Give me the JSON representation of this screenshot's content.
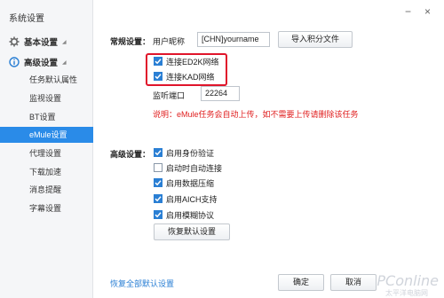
{
  "window": {
    "title": "系统设置"
  },
  "controls": {
    "minimize": "−",
    "close": "×"
  },
  "sidebar": {
    "groups": [
      {
        "label": "基本设置",
        "icon": "gear-icon"
      },
      {
        "label": "高级设置",
        "icon": "info-circle-icon"
      }
    ],
    "items": [
      {
        "label": "任务默认属性"
      },
      {
        "label": "监视设置"
      },
      {
        "label": "BT设置"
      },
      {
        "label": "eMule设置",
        "active": true
      },
      {
        "label": "代理设置"
      },
      {
        "label": "下载加速"
      },
      {
        "label": "消息提醒"
      },
      {
        "label": "字幕设置"
      }
    ]
  },
  "general": {
    "section_label": "常规设置：",
    "nickname_label": "用户昵称",
    "nickname_value": "[CHN]yourname",
    "import_button": "导入积分文件",
    "checkboxes": [
      {
        "label": "连接ED2K网络",
        "checked": true
      },
      {
        "label": "连接KAD网络",
        "checked": true
      }
    ],
    "port_label": "监听端口",
    "port_value": "22264",
    "note": "说明：eMule任务会自动上传，如不需要上传请删除该任务"
  },
  "advanced": {
    "section_label": "高级设置：",
    "checkboxes": [
      {
        "label": "启用身份验证",
        "checked": true
      },
      {
        "label": "启动时自动连接",
        "checked": false
      },
      {
        "label": "启用数据压缩",
        "checked": true
      },
      {
        "label": "启用AICH支持",
        "checked": true
      },
      {
        "label": "启用模糊协议",
        "checked": true
      }
    ],
    "restore_button": "恢复默认设置"
  },
  "footer": {
    "restore_all_link": "恢复全部默认设置",
    "ok_button": "确定",
    "cancel_button": "取消"
  },
  "watermark": {
    "main": "PConline",
    "sub": "太平洋电脑网"
  },
  "colors": {
    "accent": "#2a8be8",
    "highlight": "#e0152b",
    "note": "#e02020"
  }
}
